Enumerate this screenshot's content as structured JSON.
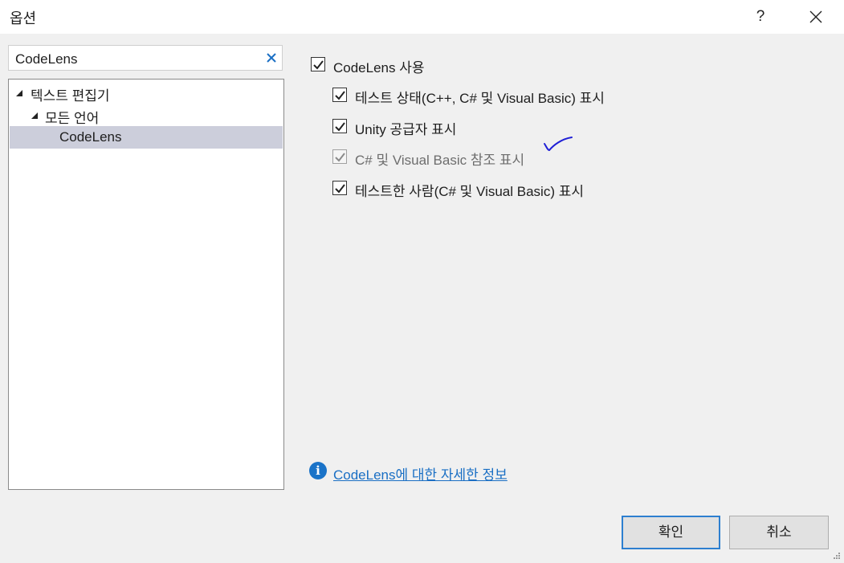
{
  "window": {
    "title": "옵션",
    "help_label": "?"
  },
  "search": {
    "value": "CodeLens"
  },
  "tree": {
    "items": [
      {
        "label": "텍스트 편집기"
      },
      {
        "label": "모든 언어"
      },
      {
        "label": "CodeLens"
      }
    ]
  },
  "settings": {
    "enable_codelens": {
      "label": "CodeLens 사용",
      "checked": true
    },
    "options": [
      {
        "label": "테스트 상태(C++, C# 및 Visual Basic) 표시",
        "checked": true,
        "enabled": true
      },
      {
        "label": "Unity 공급자 표시",
        "checked": true,
        "enabled": true
      },
      {
        "label": "C# 및 Visual Basic 참조 표시",
        "checked": true,
        "enabled": false
      },
      {
        "label": "테스트한 사람(C# 및 Visual Basic) 표시",
        "checked": true,
        "enabled": true
      }
    ]
  },
  "info": {
    "link_text": "CodeLens에 대한 자세한 정보"
  },
  "buttons": {
    "ok": "확인",
    "cancel": "취소"
  },
  "colors": {
    "accent": "#2d7fd0",
    "link": "#1a6fc4",
    "selection": "#cccedb",
    "annotation_ink": "#1f1fd6"
  }
}
